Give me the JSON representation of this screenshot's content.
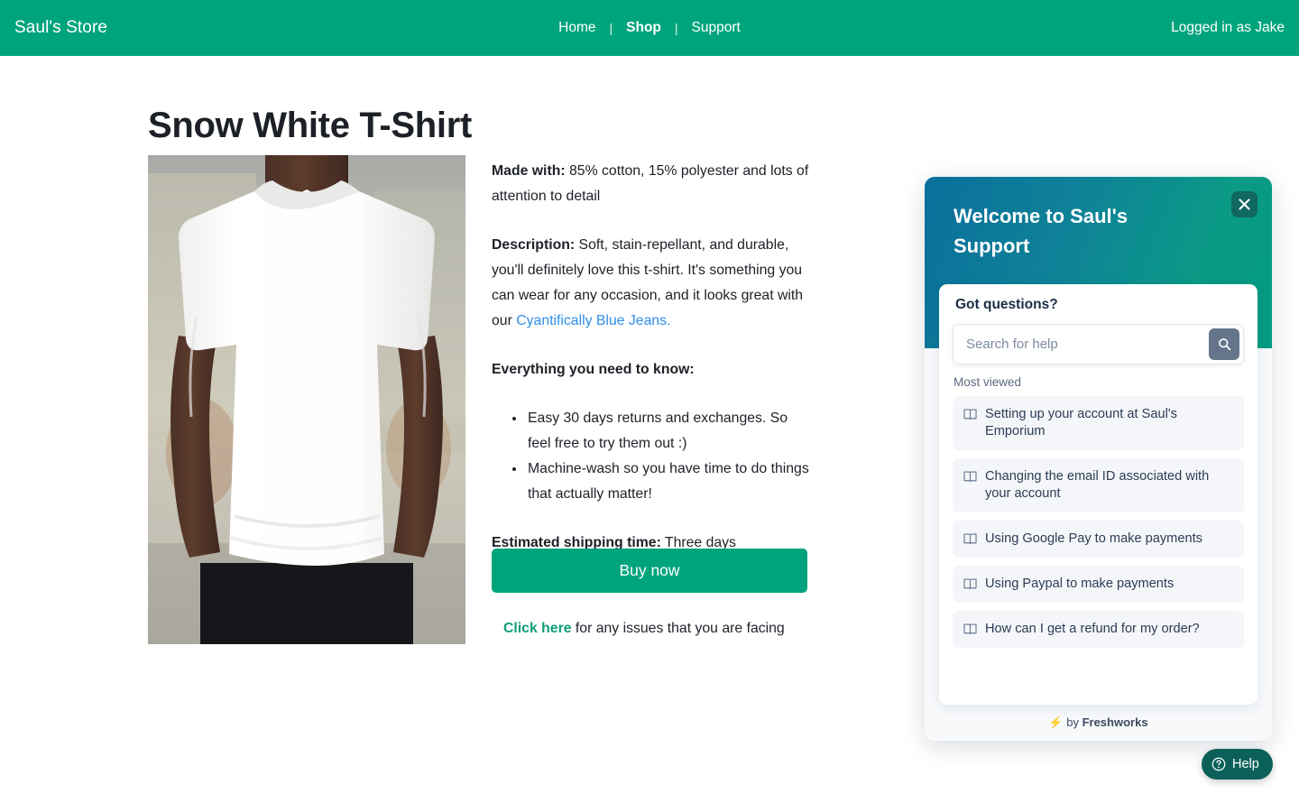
{
  "nav": {
    "brand": "Saul's Store",
    "links": [
      {
        "label": "Home",
        "active": false
      },
      {
        "label": "Shop",
        "active": true
      },
      {
        "label": "Support",
        "active": false
      }
    ],
    "separator": "|",
    "account_status": "Logged in as Jake"
  },
  "product": {
    "title": "Snow White T-Shirt",
    "made_with_label": "Made with:",
    "made_with_text": " 85% cotton, 15% polyester and lots of attention to detail",
    "description_label": "Description:",
    "description_text_before": " Soft, stain-repellant, and durable, you'll definitely love this t-shirt. It's something you can wear for any occasion, and it looks great with our ",
    "description_link": "Cyantifically Blue Jeans.",
    "need_to_know_label": "Everything you need to know:",
    "bullets": [
      "Easy 30 days returns and exchanges. So feel free to try them out :)",
      "Machine-wash so you have time to do things that actually matter!"
    ],
    "shipping_label": "Estimated shipping time:",
    "shipping_text": " Three days",
    "buy_button": "Buy now",
    "issues_link": "Click here",
    "issues_text": " for any issues that you are facing"
  },
  "widget": {
    "header_title": "Welcome to Saul's Support",
    "close_label": "close-icon",
    "got_questions": "Got questions?",
    "search_placeholder": "Search for help",
    "search_value": "",
    "most_viewed_label": "Most viewed",
    "articles": [
      "Setting up your account at Saul's Emporium",
      "Changing the email ID associated with your account",
      "Using Google Pay to make payments",
      "Using Paypal to make payments",
      "How can I get a refund for my order?"
    ],
    "powered_bolt": "⚡",
    "powered_by": " by ",
    "powered_brand": "Freshworks"
  },
  "help_button": {
    "label": "Help"
  },
  "colors": {
    "brand_green": "#00a47c",
    "link_blue": "#2f8fe8",
    "issues_green": "#0f9d77",
    "widget_gradient_start": "#0b6f9c",
    "widget_gradient_end": "#029b83",
    "help_pill": "#0b6159",
    "search_button": "#64748b"
  }
}
